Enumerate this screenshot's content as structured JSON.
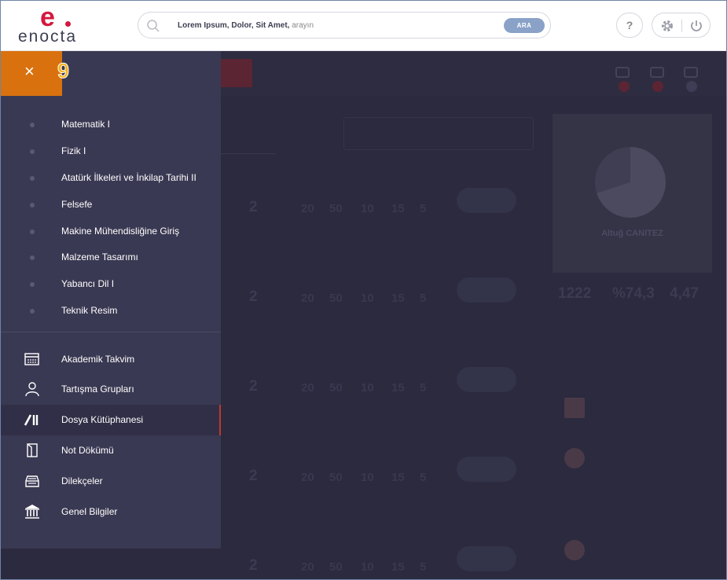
{
  "header": {
    "logo_word": "enocta",
    "logo_mark": "e",
    "search": {
      "bold_text": "Lorem Ipsum, Dolor, Sit Amet,",
      "placeholder_tail": " arayın",
      "button_label": "ARA"
    },
    "help_label": "?"
  },
  "close_tab": {
    "close_symbol": "×",
    "badge": "9"
  },
  "courses": [
    {
      "label": "Matematik I"
    },
    {
      "label": "Fizik I"
    },
    {
      "label": "Atatürk İlkeleri ve İnkilap Tarihi II"
    },
    {
      "label": "Felsefe"
    },
    {
      "label": "Makine Mühendisliğine Giriş"
    },
    {
      "label": "Malzeme Tasarımı"
    },
    {
      "label": "Yabancı Dil I"
    },
    {
      "label": "Teknik Resim"
    }
  ],
  "nav": [
    {
      "label": "Akademik Takvim",
      "icon": "calendar-icon"
    },
    {
      "label": "Tartışma Grupları",
      "icon": "user-icon"
    },
    {
      "label": "Dosya Kütüphanesi",
      "icon": "library-icon",
      "active": true
    },
    {
      "label": "Not Dökümü",
      "icon": "notes-icon"
    },
    {
      "label": "Dilekçeler",
      "icon": "inbox-tray-icon"
    },
    {
      "label": "Genel Bilgiler",
      "icon": "institution-icon"
    }
  ],
  "background": {
    "profile_name": "Altuğ CANITEZ",
    "stats": [
      "1222",
      "%74,3",
      "4,47"
    ],
    "row_value": "2",
    "row_numbers": [
      "20",
      "50",
      "10",
      "15",
      "5"
    ]
  },
  "colors": {
    "brand_red": "#d3183d",
    "panel_bg": "#3a3953",
    "close_tab": "#d9720e",
    "badge": "#f5b212",
    "active_marker": "#c0392b"
  }
}
